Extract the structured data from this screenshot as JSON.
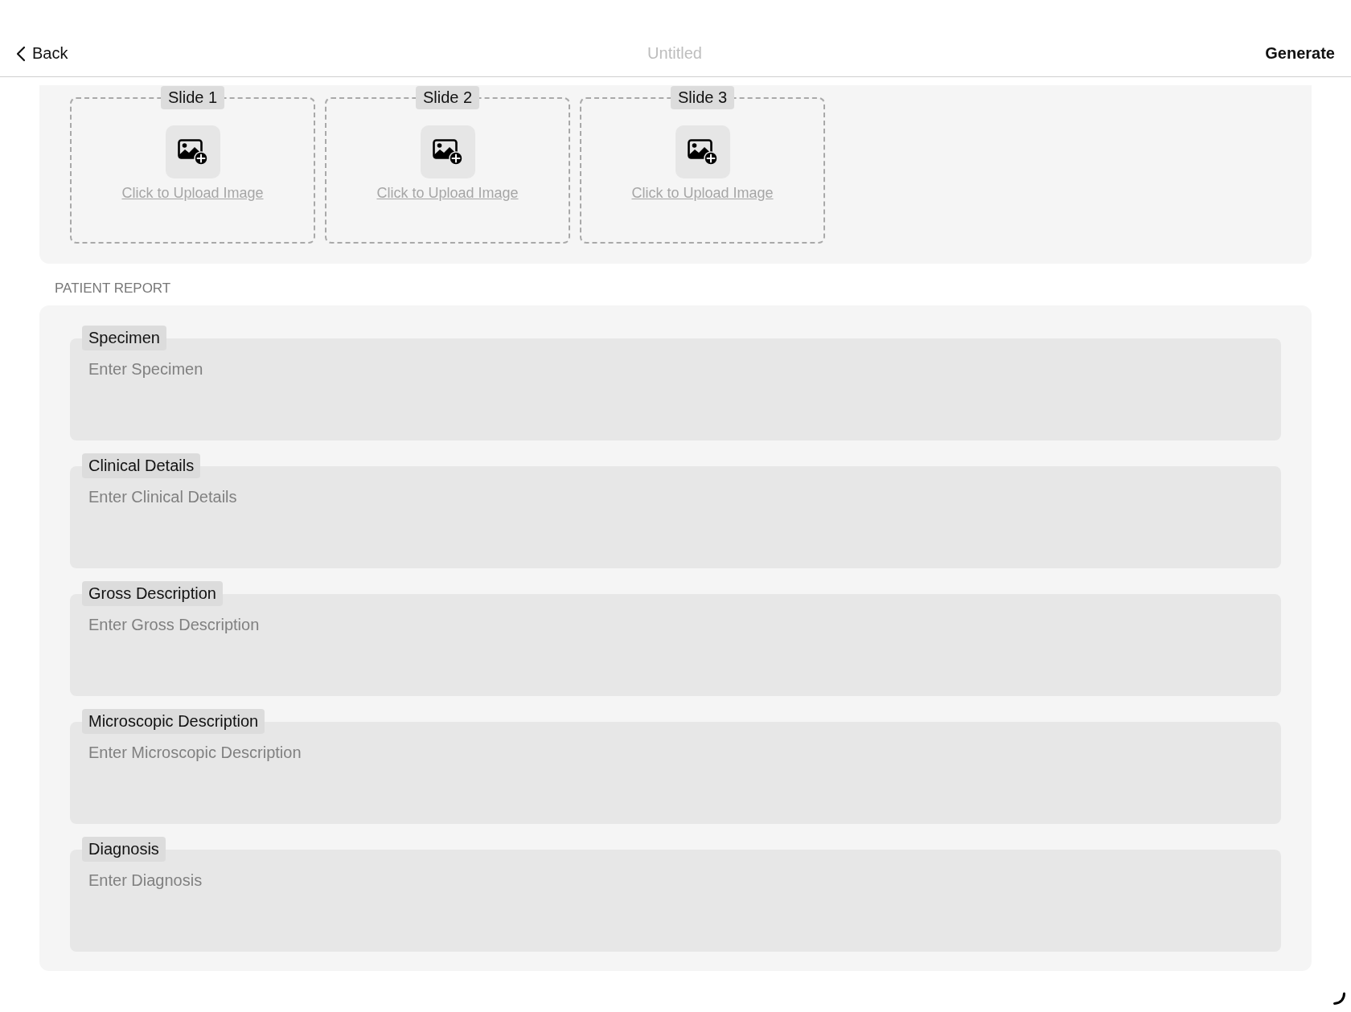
{
  "header": {
    "back_label": "Back",
    "title": "Untitled",
    "action": "Generate"
  },
  "slides": [
    {
      "label": "Slide 1",
      "upload_text": "Click to Upload Image"
    },
    {
      "label": "Slide 2",
      "upload_text": "Click to Upload Image"
    },
    {
      "label": "Slide 3",
      "upload_text": "Click to Upload Image"
    }
  ],
  "patient_report": {
    "heading": "PATIENT REPORT",
    "fields": [
      {
        "label": "Specimen",
        "placeholder": "Enter Specimen"
      },
      {
        "label": "Clinical Details",
        "placeholder": "Enter Clinical Details"
      },
      {
        "label": "Gross Description",
        "placeholder": "Enter Gross Description"
      },
      {
        "label": "Microscopic Description",
        "placeholder": "Enter Microscopic Description"
      },
      {
        "label": "Diagnosis",
        "placeholder": "Enter Diagnosis"
      }
    ]
  }
}
